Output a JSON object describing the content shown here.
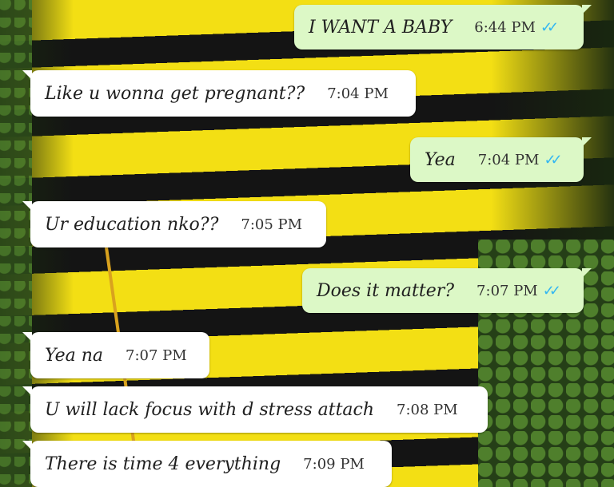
{
  "chat": {
    "messages": [
      {
        "direction": "outgoing",
        "text": "I WANT A BABY",
        "time": "6:44 PM",
        "status": "read"
      },
      {
        "direction": "incoming",
        "text": "Like u wonna get pregnant??",
        "time": "7:04 PM"
      },
      {
        "direction": "outgoing",
        "text": "Yea",
        "time": "7:04 PM",
        "status": "read"
      },
      {
        "direction": "incoming",
        "text": "Ur education nko??",
        "time": "7:05 PM"
      },
      {
        "direction": "outgoing",
        "text": "Does it matter?",
        "time": "7:07 PM",
        "status": "read"
      },
      {
        "direction": "incoming",
        "text": "Yea na",
        "time": "7:07 PM"
      },
      {
        "direction": "incoming",
        "text": "U will lack focus with d stress attach",
        "time": "7:08 PM"
      },
      {
        "direction": "incoming",
        "text": "There is time 4 everything",
        "time": "7:09 PM"
      }
    ],
    "read_tick_glyph": "✓✓",
    "colors": {
      "incoming_bubble": "#ffffff",
      "outgoing_bubble": "#dcf8c6",
      "read_tick": "#34b7f1"
    }
  }
}
